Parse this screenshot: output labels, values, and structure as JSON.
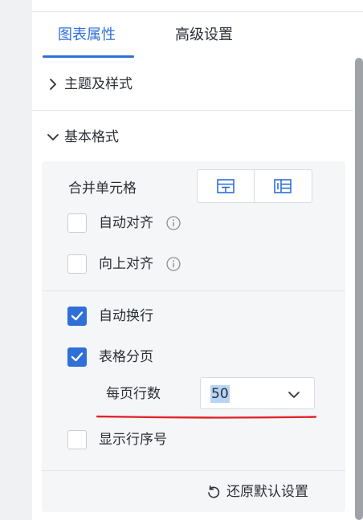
{
  "tabs": [
    {
      "label": "图表属性",
      "active": true
    },
    {
      "label": "高级设置",
      "active": false
    }
  ],
  "sections": {
    "theme": {
      "label": "主题及样式",
      "expanded": false
    },
    "basic": {
      "label": "基本格式",
      "expanded": true
    }
  },
  "basic_format": {
    "merge_cells_label": "合并单元格",
    "merge_options": [
      "merge-rows-icon",
      "merge-columns-icon"
    ],
    "auto_align": {
      "label": "自动对齐",
      "checked": false
    },
    "align_top": {
      "label": "向上对齐",
      "checked": false
    },
    "auto_wrap": {
      "label": "自动换行",
      "checked": true
    },
    "paging": {
      "label": "表格分页",
      "checked": true
    },
    "rows_per_page": {
      "label": "每页行数",
      "value": "50"
    },
    "show_row_number": {
      "label": "显示行序号",
      "checked": false
    },
    "reset_label": "还原默认设置"
  },
  "colors": {
    "accent": "#2f6fd8",
    "annotation": "#e0252b"
  }
}
